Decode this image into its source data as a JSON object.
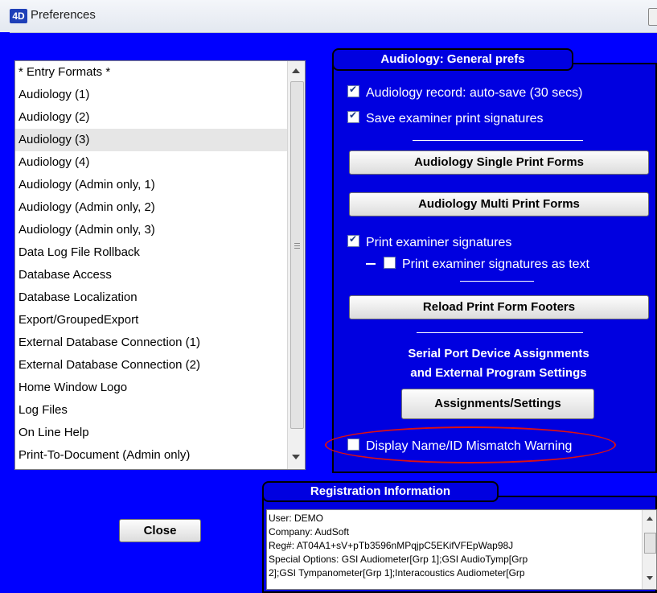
{
  "window": {
    "title": "Preferences",
    "icon": "4D"
  },
  "pref_list": {
    "items": [
      "* Entry Formats *",
      "Audiology (1)",
      "Audiology (2)",
      "Audiology (3)",
      "Audiology (4)",
      "Audiology (Admin only, 1)",
      "Audiology (Admin only, 2)",
      "Audiology (Admin only, 3)",
      "Data Log File Rollback",
      "Database Access",
      "Database Localization",
      "Export/GroupedExport",
      "External Database Connection (1)",
      "External Database Connection (2)",
      "Home Window Logo",
      "Log Files",
      "On Line Help",
      "Print-To-Document (Admin only)"
    ],
    "selected": "Audiology (3)"
  },
  "general_prefs": {
    "title": "Audiology: General prefs",
    "autosave_label": "Audiology record: auto-save (30 secs)",
    "autosave_checked": true,
    "save_sig_label": "Save examiner print signatures",
    "save_sig_checked": true,
    "single_forms_button": "Audiology Single Print Forms",
    "multi_forms_button": "Audiology Multi Print Forms",
    "print_sig_label": "Print examiner signatures",
    "print_sig_checked": true,
    "print_sig_text_label": "Print examiner signatures as text",
    "print_sig_text_checked": false,
    "reload_footers_button": "Reload Print Form Footers",
    "serial_line1": "Serial Port Device Assignments",
    "serial_line2": "and External Program Settings",
    "assignments_button": "Assignments/Settings",
    "mismatch_label": "Display Name/ID Mismatch Warning",
    "mismatch_checked": false
  },
  "registration": {
    "title": "Registration Information",
    "lines": [
      "User: DEMO",
      "Company: AudSoft",
      "Reg#: AT04A1+sV+pTb3596nMPqjpC5EKifVFEpWap98J",
      "Special Options: GSI Audiometer[Grp 1];GSI AudioTymp[Grp",
      "2];GSI Tympanometer[Grp 1];Interacoustics Audiometer[Grp"
    ]
  },
  "close_button": "Close",
  "colors": {
    "panel_blue": "#0000e0",
    "annotation_red": "#e01010"
  }
}
